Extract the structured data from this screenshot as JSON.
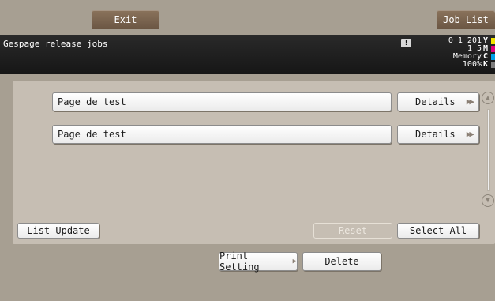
{
  "top_bar": {
    "exit_label": "Exit",
    "job_list_label": "Job List"
  },
  "header": {
    "title": "Gespage release jobs",
    "alert_icon": "exclamation-icon",
    "counter_line1": "0 1 201",
    "counter_line2": "1 5",
    "memory_label": "Memory",
    "memory_value": "100%"
  },
  "toner": [
    {
      "letter": "Y",
      "color": "#f2e300"
    },
    {
      "letter": "M",
      "color": "#e3007d"
    },
    {
      "letter": "C",
      "color": "#00a0e9"
    },
    {
      "letter": "K",
      "color": "#7d7d7d"
    }
  ],
  "jobs": [
    {
      "name": "Page de test",
      "details_label": "Details"
    },
    {
      "name": "Page de test",
      "details_label": "Details"
    }
  ],
  "actions": {
    "list_update": "List Update",
    "reset": "Reset",
    "select_all": "Select All"
  },
  "bottom": {
    "print_setting": "Print Setting",
    "delete": "Delete"
  },
  "colors": {
    "frame": "#a79f92",
    "panel": "#c6beb3",
    "header": "#1d1d1d",
    "tab": "#7a634d"
  }
}
